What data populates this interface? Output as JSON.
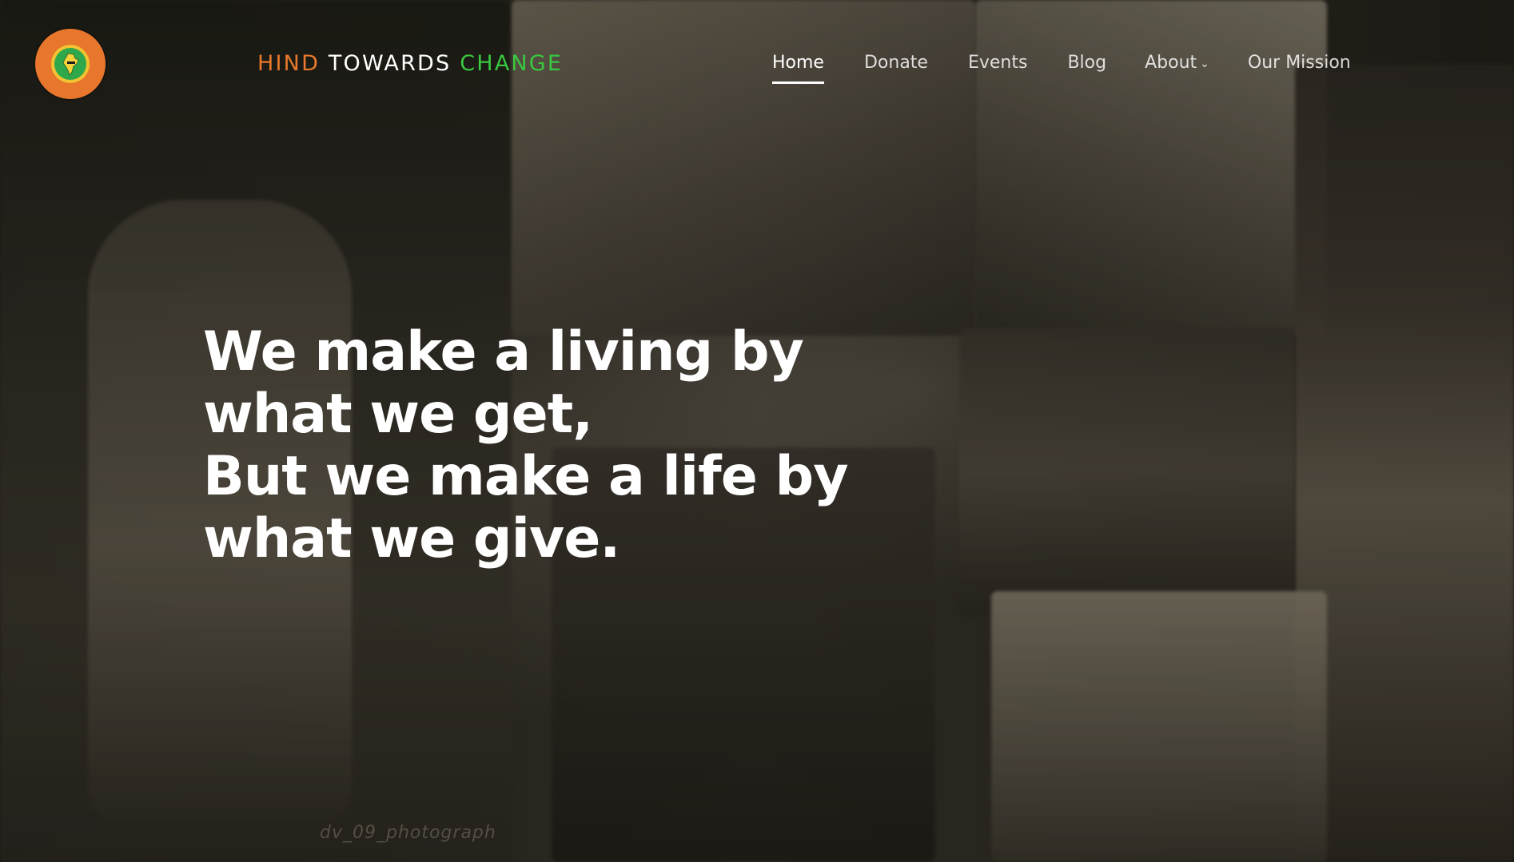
{
  "brand": {
    "word1": "HIND",
    "word2": "TOWARDS",
    "word3": "CHANGE",
    "colors": {
      "word1": "#e8792c",
      "word2": "#ffffff",
      "word3": "#39c83f"
    },
    "logo_icon": "india-map-emblem-icon"
  },
  "nav": {
    "active": "Home",
    "items": [
      {
        "label": "Home"
      },
      {
        "label": "Donate"
      },
      {
        "label": "Events"
      },
      {
        "label": "Blog"
      },
      {
        "label": "About",
        "dropdown": true,
        "dropdown_icon": "chevron-down-icon"
      },
      {
        "label": "Our Mission"
      }
    ]
  },
  "hero": {
    "lines": [
      "We make a living by",
      "what we get,",
      "But we make a life by",
      "what we give."
    ]
  },
  "photo": {
    "watermark": "dv_09_photograph"
  }
}
